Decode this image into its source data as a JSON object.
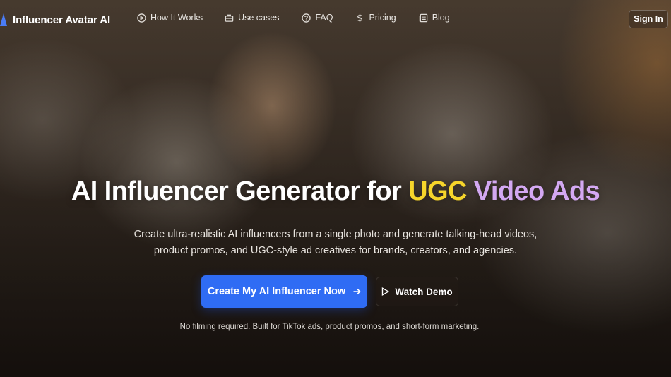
{
  "nav": {
    "brand": "Influencer Avatar AI",
    "links": [
      {
        "label": "How It Works",
        "icon": "play-circle-icon"
      },
      {
        "label": "Use cases",
        "icon": "briefcase-icon"
      },
      {
        "label": "FAQ",
        "icon": "help-circle-icon"
      },
      {
        "label": "Pricing",
        "icon": "dollar-icon"
      },
      {
        "label": "Blog",
        "icon": "newspaper-icon"
      }
    ],
    "signin": "Sign In"
  },
  "hero": {
    "headline_part1": "AI Influencer Generator for ",
    "headline_ugc": "UGC",
    "headline_video": "Video Ads",
    "subheadline": "Create ultra-realistic AI influencers from a single photo and generate talking-head videos, product promos, and UGC-style ad creatives for brands, creators, and agencies.",
    "cta_primary": "Create My AI Influencer Now",
    "cta_secondary": "Watch Demo",
    "footnote": "No filming required. Built for TikTok ads, product promos, and short-form marketing."
  },
  "colors": {
    "accent_blue": "#2f6cf4",
    "highlight_yellow": "#f6d52b",
    "highlight_purple": "#d3a8f2"
  }
}
